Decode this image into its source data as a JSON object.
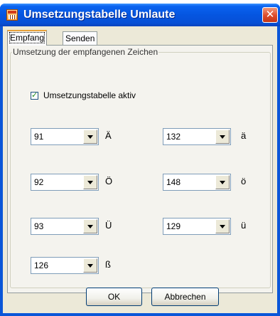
{
  "window": {
    "title": "Umsetzungstabelle Umlaute",
    "close_symbol": "✕"
  },
  "tabs": [
    {
      "label": "Empfang",
      "active": true
    },
    {
      "label": "Senden",
      "active": false
    }
  ],
  "group": {
    "title": "Umsetzung der empfangenen Zeichen",
    "checkbox": {
      "label": "Umsetzungstabelle aktiv",
      "checked": true,
      "mark": "✓"
    }
  },
  "mappings": [
    {
      "value": "91",
      "char": "Ä"
    },
    {
      "value": "132",
      "char": "ä"
    },
    {
      "value": "92",
      "char": "Ö"
    },
    {
      "value": "148",
      "char": "ö"
    },
    {
      "value": "93",
      "char": "Ü"
    },
    {
      "value": "129",
      "char": "ü"
    },
    {
      "value": "126",
      "char": "ß"
    }
  ],
  "buttons": {
    "ok": "OK",
    "cancel": "Abbrechen"
  }
}
